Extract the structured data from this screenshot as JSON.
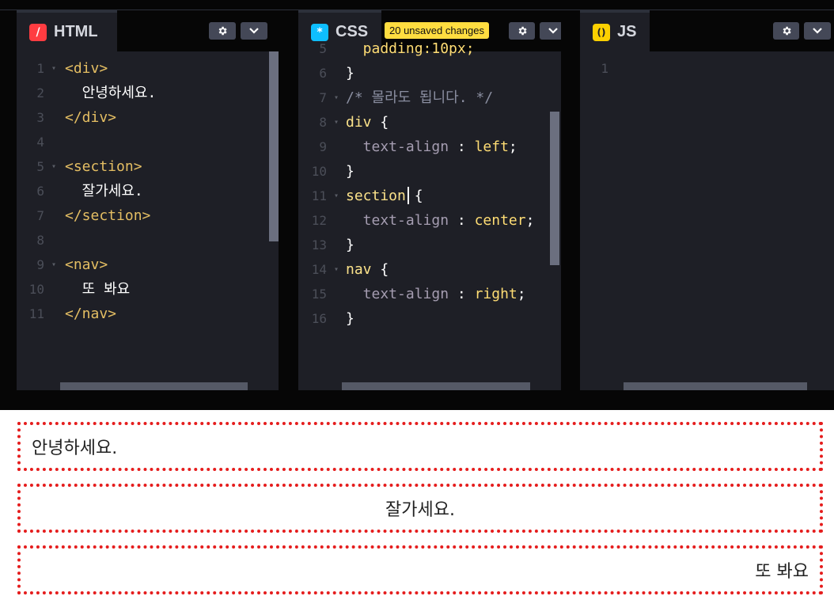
{
  "panels": {
    "html": {
      "label": "HTML",
      "icon": "/",
      "lines": [
        {
          "n": "1",
          "fold": true,
          "segments": [
            {
              "t": "<div>",
              "c": "tag"
            }
          ]
        },
        {
          "n": "2",
          "fold": false,
          "segments": [
            {
              "t": "  안녕하세요.",
              "c": "plain"
            }
          ]
        },
        {
          "n": "3",
          "fold": false,
          "segments": [
            {
              "t": "</div>",
              "c": "tag"
            }
          ]
        },
        {
          "n": "4",
          "fold": false,
          "segments": []
        },
        {
          "n": "5",
          "fold": true,
          "segments": [
            {
              "t": "<section>",
              "c": "tag"
            }
          ]
        },
        {
          "n": "6",
          "fold": false,
          "segments": [
            {
              "t": "  잘가세요.",
              "c": "plain"
            }
          ]
        },
        {
          "n": "7",
          "fold": false,
          "segments": [
            {
              "t": "</section>",
              "c": "tag"
            }
          ]
        },
        {
          "n": "8",
          "fold": false,
          "segments": []
        },
        {
          "n": "9",
          "fold": true,
          "segments": [
            {
              "t": "<nav>",
              "c": "tag"
            }
          ]
        },
        {
          "n": "10",
          "fold": false,
          "segments": [
            {
              "t": "  또 봐요",
              "c": "plain"
            }
          ]
        },
        {
          "n": "11",
          "fold": false,
          "segments": [
            {
              "t": "</nav>",
              "c": "tag"
            }
          ]
        }
      ]
    },
    "css": {
      "label": "CSS",
      "icon": "*",
      "unsaved": "20 unsaved changes",
      "lines": [
        {
          "n": "5",
          "fold": false,
          "segments": [
            {
              "t": "  padding:10px;",
              "c": "val"
            }
          ]
        },
        {
          "n": "6",
          "fold": false,
          "segments": [
            {
              "t": "}",
              "c": "plain"
            }
          ]
        },
        {
          "n": "7",
          "fold": true,
          "segments": [
            {
              "t": "/* 몰라도 됩니다. */",
              "c": "cmt"
            }
          ]
        },
        {
          "n": "8",
          "fold": true,
          "segments": [
            {
              "t": "div",
              "c": "sel"
            },
            {
              "t": " {",
              "c": "plain"
            }
          ]
        },
        {
          "n": "9",
          "fold": false,
          "segments": [
            {
              "t": "  text-align",
              "c": "prop"
            },
            {
              "t": " : ",
              "c": "plain"
            },
            {
              "t": "left",
              "c": "val"
            },
            {
              "t": ";",
              "c": "plain"
            }
          ]
        },
        {
          "n": "10",
          "fold": false,
          "segments": [
            {
              "t": "}",
              "c": "plain"
            }
          ]
        },
        {
          "n": "11",
          "fold": true,
          "segments": [
            {
              "t": "section",
              "c": "sel"
            },
            {
              "t": " {",
              "c": "plain"
            }
          ]
        },
        {
          "n": "12",
          "fold": false,
          "segments": [
            {
              "t": "  text-align",
              "c": "prop"
            },
            {
              "t": " : ",
              "c": "plain"
            },
            {
              "t": "center",
              "c": "val"
            },
            {
              "t": ";",
              "c": "plain"
            }
          ]
        },
        {
          "n": "13",
          "fold": false,
          "segments": [
            {
              "t": "}",
              "c": "plain"
            }
          ]
        },
        {
          "n": "14",
          "fold": true,
          "segments": [
            {
              "t": "nav",
              "c": "sel"
            },
            {
              "t": " {",
              "c": "plain"
            }
          ]
        },
        {
          "n": "15",
          "fold": false,
          "segments": [
            {
              "t": "  text-align",
              "c": "prop"
            },
            {
              "t": " : ",
              "c": "plain"
            },
            {
              "t": "right",
              "c": "val"
            },
            {
              "t": ";",
              "c": "plain"
            }
          ]
        },
        {
          "n": "16",
          "fold": false,
          "segments": [
            {
              "t": "}",
              "c": "plain"
            }
          ]
        }
      ]
    },
    "js": {
      "label": "JS",
      "icon": "()",
      "lines": [
        {
          "n": "1",
          "fold": false,
          "segments": []
        }
      ]
    }
  },
  "colors": {
    "html_icon": "#ff3c41",
    "css_icon": "#0ebeff",
    "js_icon": "#fcd000",
    "result_border": "#e51d1d"
  },
  "result": {
    "div_text": "안녕하세요.",
    "section_text": "잘가세요.",
    "nav_text": "또 봐요"
  }
}
